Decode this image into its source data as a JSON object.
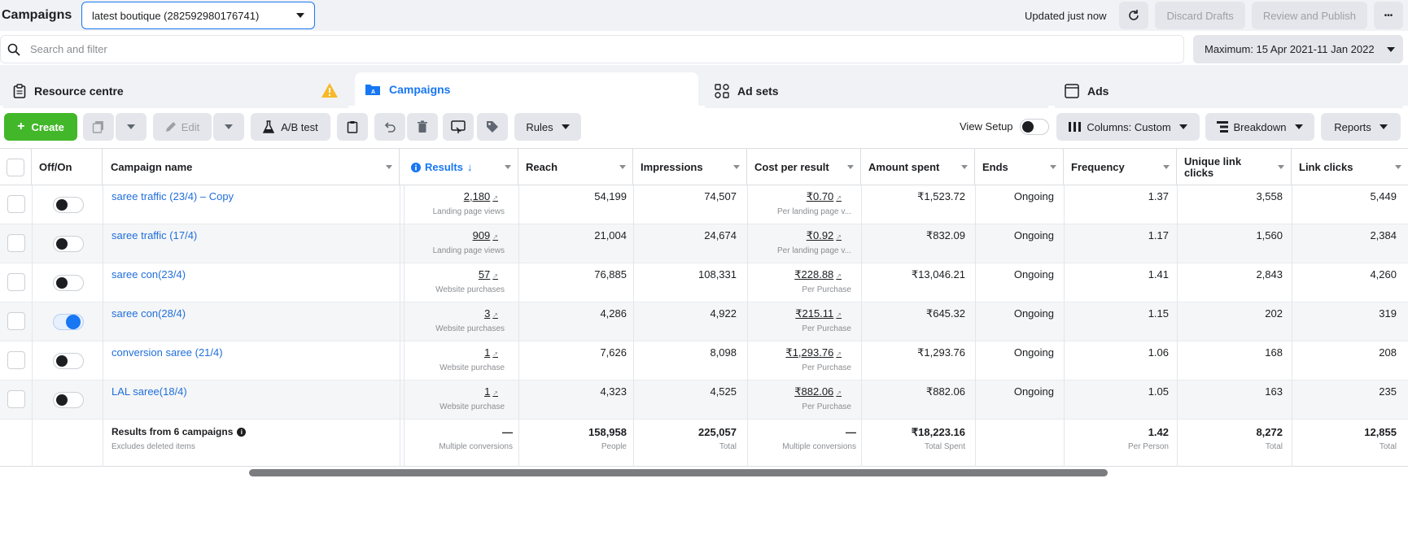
{
  "header": {
    "title": "Campaigns",
    "account": "latest boutique (282592980176741)",
    "updated": "Updated just now",
    "discard": "Discard Drafts",
    "review": "Review and Publish",
    "more": "•••"
  },
  "search": {
    "placeholder": "Search and filter"
  },
  "date_range": "Maximum: 15 Apr 2021-11 Jan 2022",
  "tabs": [
    {
      "label": "Resource centre"
    },
    {
      "label": "Campaigns"
    },
    {
      "label": "Ad sets"
    },
    {
      "label": "Ads"
    }
  ],
  "toolbar": {
    "create": "Create",
    "edit": "Edit",
    "ab_test": "A/B test",
    "rules": "Rules",
    "view_setup": "View Setup",
    "columns": "Columns: Custom",
    "breakdown": "Breakdown",
    "reports": "Reports"
  },
  "columns": [
    "Off/On",
    "Campaign name",
    "Results",
    "Reach",
    "Impressions",
    "Cost per result",
    "Amount spent",
    "Ends",
    "Frequency",
    "Unique link clicks",
    "Link clicks"
  ],
  "rows": [
    {
      "name": "saree traffic (23/4) – Copy",
      "on": false,
      "results": "2,180",
      "results_sub": "Landing page views",
      "reach": "54,199",
      "impressions": "74,507",
      "cpr": "₹0.70",
      "cpr_sub": "Per landing page v...",
      "spent": "₹1,523.72",
      "ends": "Ongoing",
      "freq": "1.37",
      "ulc": "3,558",
      "lc": "5,449"
    },
    {
      "name": "saree traffic (17/4)",
      "on": false,
      "results": "909",
      "results_sub": "Landing page views",
      "reach": "21,004",
      "impressions": "24,674",
      "cpr": "₹0.92",
      "cpr_sub": "Per landing page v...",
      "spent": "₹832.09",
      "ends": "Ongoing",
      "freq": "1.17",
      "ulc": "1,560",
      "lc": "2,384"
    },
    {
      "name": "saree con(23/4)",
      "on": false,
      "results": "57",
      "results_sub": "Website purchases",
      "reach": "76,885",
      "impressions": "108,331",
      "cpr": "₹228.88",
      "cpr_sub": "Per Purchase",
      "spent": "₹13,046.21",
      "ends": "Ongoing",
      "freq": "1.41",
      "ulc": "2,843",
      "lc": "4,260"
    },
    {
      "name": "saree con(28/4)",
      "on": true,
      "results": "3",
      "results_sub": "Website purchases",
      "reach": "4,286",
      "impressions": "4,922",
      "cpr": "₹215.11",
      "cpr_sub": "Per Purchase",
      "spent": "₹645.32",
      "ends": "Ongoing",
      "freq": "1.15",
      "ulc": "202",
      "lc": "319"
    },
    {
      "name": "conversion saree (21/4)",
      "on": false,
      "results": "1",
      "results_sub": "Website purchase",
      "reach": "7,626",
      "impressions": "8,098",
      "cpr": "₹1,293.76",
      "cpr_sub": "Per Purchase",
      "spent": "₹1,293.76",
      "ends": "Ongoing",
      "freq": "1.06",
      "ulc": "168",
      "lc": "208"
    },
    {
      "name": "LAL saree(18/4)",
      "on": false,
      "results": "1",
      "results_sub": "Website purchase",
      "reach": "4,323",
      "impressions": "4,525",
      "cpr": "₹882.06",
      "cpr_sub": "Per Purchase",
      "spent": "₹882.06",
      "ends": "Ongoing",
      "freq": "1.05",
      "ulc": "163",
      "lc": "235"
    }
  ],
  "totals": {
    "label": "Results from 6 campaigns",
    "sub": "Excludes deleted items",
    "results": "—",
    "results_sub": "Multiple conversions",
    "reach": "158,958",
    "reach_sub": "People",
    "impressions": "225,057",
    "impressions_sub": "Total",
    "cpr": "—",
    "cpr_sub": "Multiple conversions",
    "spent": "₹18,223.16",
    "spent_sub": "Total Spent",
    "freq": "1.42",
    "freq_sub": "Per Person",
    "ulc": "8,272",
    "ulc_sub": "Total",
    "lc": "12,855",
    "lc_sub": "Total"
  },
  "colors": {
    "accent": "#1877f2",
    "create": "#42b72a",
    "link": "#216fdb"
  }
}
